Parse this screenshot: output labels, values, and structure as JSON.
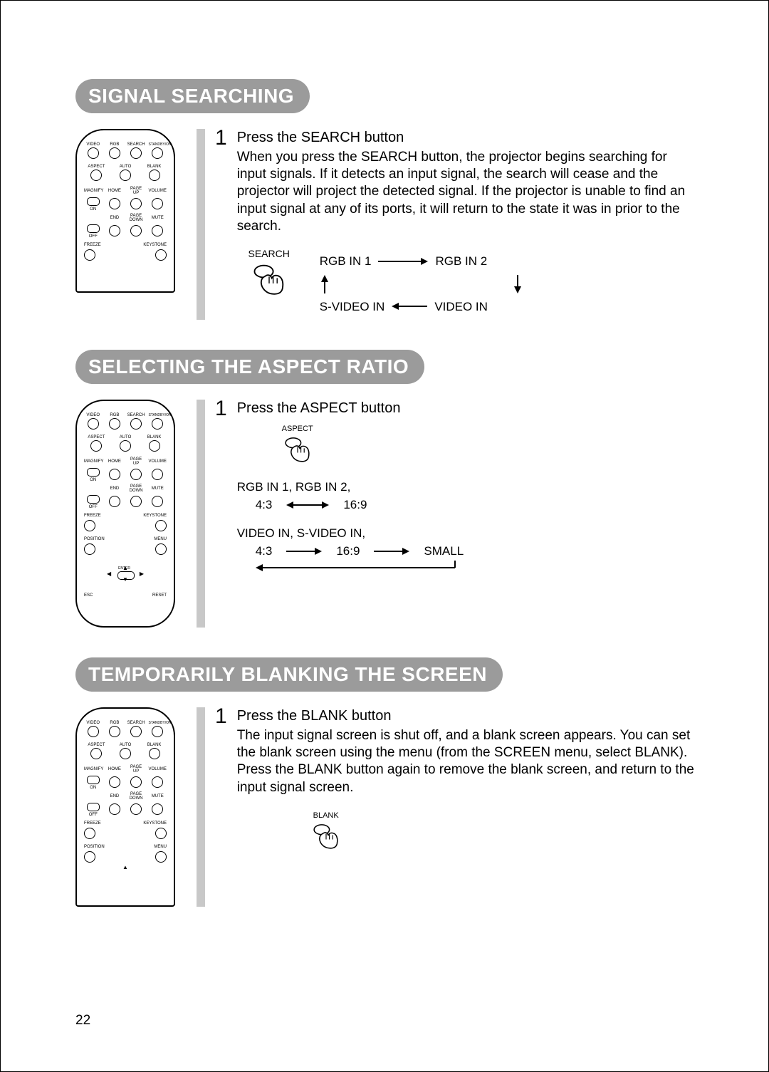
{
  "page_number": "22",
  "remote_labels": {
    "video": "VIDEO",
    "rgb": "RGB",
    "search": "SEARCH",
    "standby": "STANDBY/ON",
    "aspect": "ASPECT",
    "auto": "AUTO",
    "blank": "BLANK",
    "magnify": "MAGNIFY",
    "home": "HOME",
    "pageup": "PAGE UP",
    "volume": "VOLUME",
    "on": "ON",
    "off": "OFF",
    "end": "END",
    "pagedown": "PAGE DOWN",
    "mute": "MUTE",
    "freeze": "FREEZE",
    "keystone": "KEYSTONE",
    "position": "POSITION",
    "menu": "MENU",
    "enter": "ENTER",
    "esc": "ESC",
    "reset": "RESET"
  },
  "sections": [
    {
      "heading": "SIGNAL SEARCHING",
      "remote_variant": "short",
      "step_num": "1",
      "step_title": "Press the SEARCH button",
      "step_body": "When you press the SEARCH button, the projector begins searching for input signals. If it detects an input signal, the search will cease and the projector will project the detected signal. If the projector is unable to find an input signal at any of its ports, it will return to the state it was in prior to the search.",
      "press_label": "SEARCH",
      "flow": {
        "rgb1": "RGB IN 1",
        "rgb2": "RGB IN 2",
        "svideo": "S-VIDEO IN",
        "video": "VIDEO IN"
      }
    },
    {
      "heading": "SELECTING THE ASPECT RATIO",
      "remote_variant": "tall",
      "step_num": "1",
      "step_title": "Press the ASPECT button",
      "press_label": "ASPECT",
      "aspect": {
        "group1_label": "RGB IN 1, RGB IN 2,",
        "group1_a": "4:3",
        "group1_b": "16:9",
        "group2_label": "VIDEO IN, S-VIDEO IN,",
        "group2_a": "4:3",
        "group2_b": "16:9",
        "group2_c": "SMALL"
      }
    },
    {
      "heading": "TEMPORARILY BLANKING THE SCREEN",
      "remote_variant": "medium",
      "step_num": "1",
      "step_title": "Press the BLANK button",
      "step_body": "The input signal screen is shut off, and a blank screen appears. You can set the blank screen using the menu (from the SCREEN menu, select BLANK). Press the BLANK button again to remove the blank screen, and return to the input signal screen.",
      "press_label": "BLANK"
    }
  ]
}
